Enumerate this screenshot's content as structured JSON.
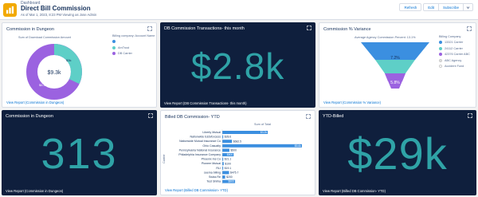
{
  "header": {
    "breadcrumb": "Dashboard",
    "title": "Direct Bill Commission",
    "as_of": "As of Mar 1, 2023, 8:23 PM·Viewing as Jose Admin",
    "refresh": "Refresh",
    "edit": "Edit",
    "subscribe": "Subscribe"
  },
  "panels": {
    "p1": {
      "title": "Commission in Dungeon",
      "chart_heading": "Sum of Download Commission Amount",
      "center_value": "$9.3k",
      "legend_title": "Billing company: Account Name",
      "legend": [
        {
          "label": "",
          "color": "#3b8fe0"
        },
        {
          "label": "AmTrust",
          "color": "#5ecfc7"
        },
        {
          "label": "DB Carrier",
          "color": "#9b62e0"
        }
      ],
      "slice_labels": [
        "$3k",
        "$6.3k"
      ],
      "view_report": "View Report (Commission in Dungeon)"
    },
    "p2": {
      "title": "DB Commission Transactions- this month",
      "value": "$2.8k",
      "view_report": "View Report (DB Commission Transactions- this month)"
    },
    "p3": {
      "title": "Commission % Variance",
      "chart_heading": "Average Agency Commission Percent: 13.1%",
      "legend_title": "Billing Company",
      "legend": [
        {
          "label": "13321 Carrier",
          "color": "#3b8fe0"
        },
        {
          "label": "24112 Carrier",
          "color": "#5ecfc7"
        },
        {
          "label": "42376 Carrier ABC",
          "color": "#9b62e0"
        },
        {
          "label": "ABC Agency",
          "color": "#e0e0e0"
        },
        {
          "label": "Accident Fund",
          "color": "#ffffff"
        }
      ],
      "funnel_labels": [
        "7.2%",
        "5.8%"
      ],
      "view_report": "View Report (Commission % Variance)"
    },
    "p4": {
      "title": "Commission in Dungeon",
      "value": "313",
      "view_report": "View Report (Commission in Dungeon)"
    },
    "p5": {
      "title": "Billed DB Commission- YTD",
      "x_heading": "Sum of Total",
      "y_axis": "Carrier",
      "view_report": "View Report (Billed DB Commission- YTD)"
    },
    "p6": {
      "title": "YTD-Billed",
      "value": "$29k",
      "view_report": "View Report (Billed DB Commission- YTD)"
    }
  },
  "chart_data": [
    {
      "type": "pie",
      "title": "Sum of Download Commission Amount",
      "categories": [
        "AmTrust",
        "DB Carrier"
      ],
      "values": [
        3,
        6.3
      ],
      "total_label": "$9.3k"
    },
    {
      "type": "bar",
      "title": "Billed DB Commission- YTD",
      "xlabel": "Sum of Total",
      "ylabel": "Carrier",
      "categories": [
        "Liberty Mutual",
        "Nationwide E&S/Excess",
        "Nationwide Mutual Insurance Co",
        "Ohio Casualty",
        "Pennsylvania National Insurance",
        "Philadelphia Insurance Company",
        "Phoenix Ins Co",
        "Pioneer Mutual",
        "RLI",
        "seema billing",
        "Swiss Re",
        "Test Shilha"
      ],
      "values": [
        3200,
        28.6,
        682.5,
        5600,
        500,
        800,
        21.1,
        100,
        19.1,
        475.7,
        200,
        900
      ],
      "value_labels": [
        "$3.2k",
        "$28.6",
        "$682.5",
        "$5.6k",
        "$500",
        "$800",
        "$21.1",
        "$100",
        "$19.1",
        "$475.7",
        "$200",
        "$900"
      ]
    }
  ]
}
